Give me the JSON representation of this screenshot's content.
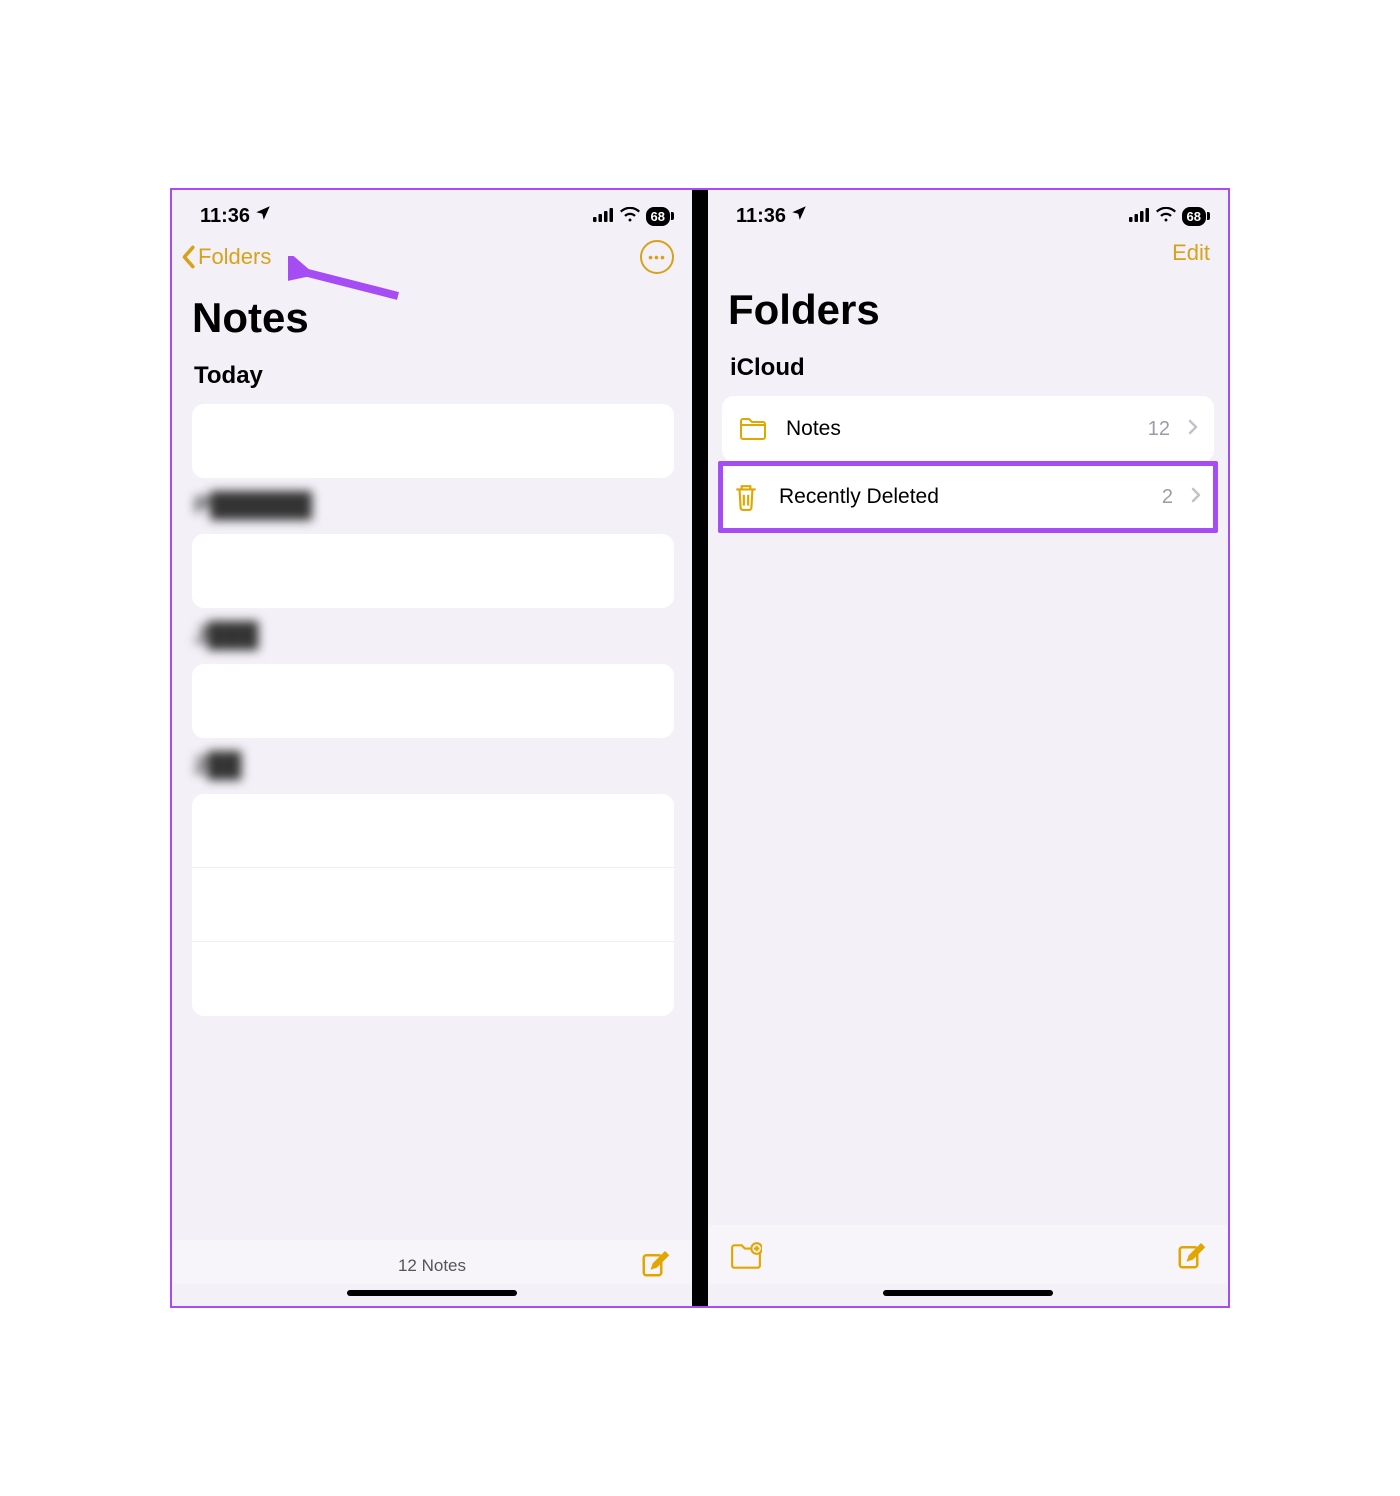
{
  "status": {
    "time": "11:36",
    "battery": "68"
  },
  "left": {
    "backLabel": "Folders",
    "title": "Notes",
    "todayLabel": "Today",
    "sectionP": "P",
    "sectionJ": "J",
    "section2": "2",
    "footerCount": "12 Notes"
  },
  "right": {
    "editLabel": "Edit",
    "title": "Folders",
    "group": "iCloud",
    "folders": [
      {
        "name": "Notes",
        "count": "12"
      },
      {
        "name": "Recently Deleted",
        "count": "2"
      }
    ]
  }
}
